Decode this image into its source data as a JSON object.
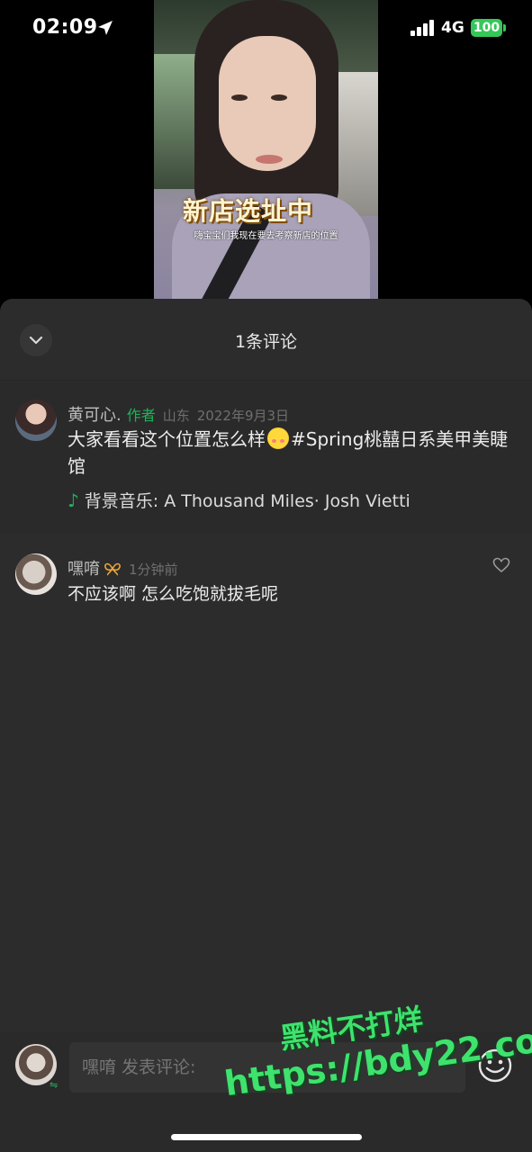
{
  "status_bar": {
    "time": "02:09",
    "network": "4G",
    "battery": "100"
  },
  "video": {
    "overlay_title": "新店选址中",
    "subtitle": "嗨宝宝们我现在要去考察新店的位置"
  },
  "comments_panel": {
    "title": "1条评论",
    "author_post": {
      "name": "黄可心.",
      "tag": "作者",
      "location": "山东",
      "date": "2022年9月3日",
      "text_before_emoji": "大家看看这个位置怎么样",
      "text_after_emoji": "#Spring桃囍日系美甲美睫馆",
      "music": "背景音乐: A Thousand Miles· Josh Vietti"
    },
    "comments": [
      {
        "name": "嘿唷",
        "time": "1分钟前",
        "text": "不应该啊  怎么吃饱就拔毛呢"
      }
    ]
  },
  "composer": {
    "placeholder": "嘿唷 发表评论:"
  },
  "watermark": {
    "line1": "黑料不打烊",
    "line2": "https://bdy22.co"
  },
  "colors": {
    "accent_green": "#1fb35b",
    "panel_bg": "#2c2c2c",
    "battery_green": "#36c759"
  }
}
